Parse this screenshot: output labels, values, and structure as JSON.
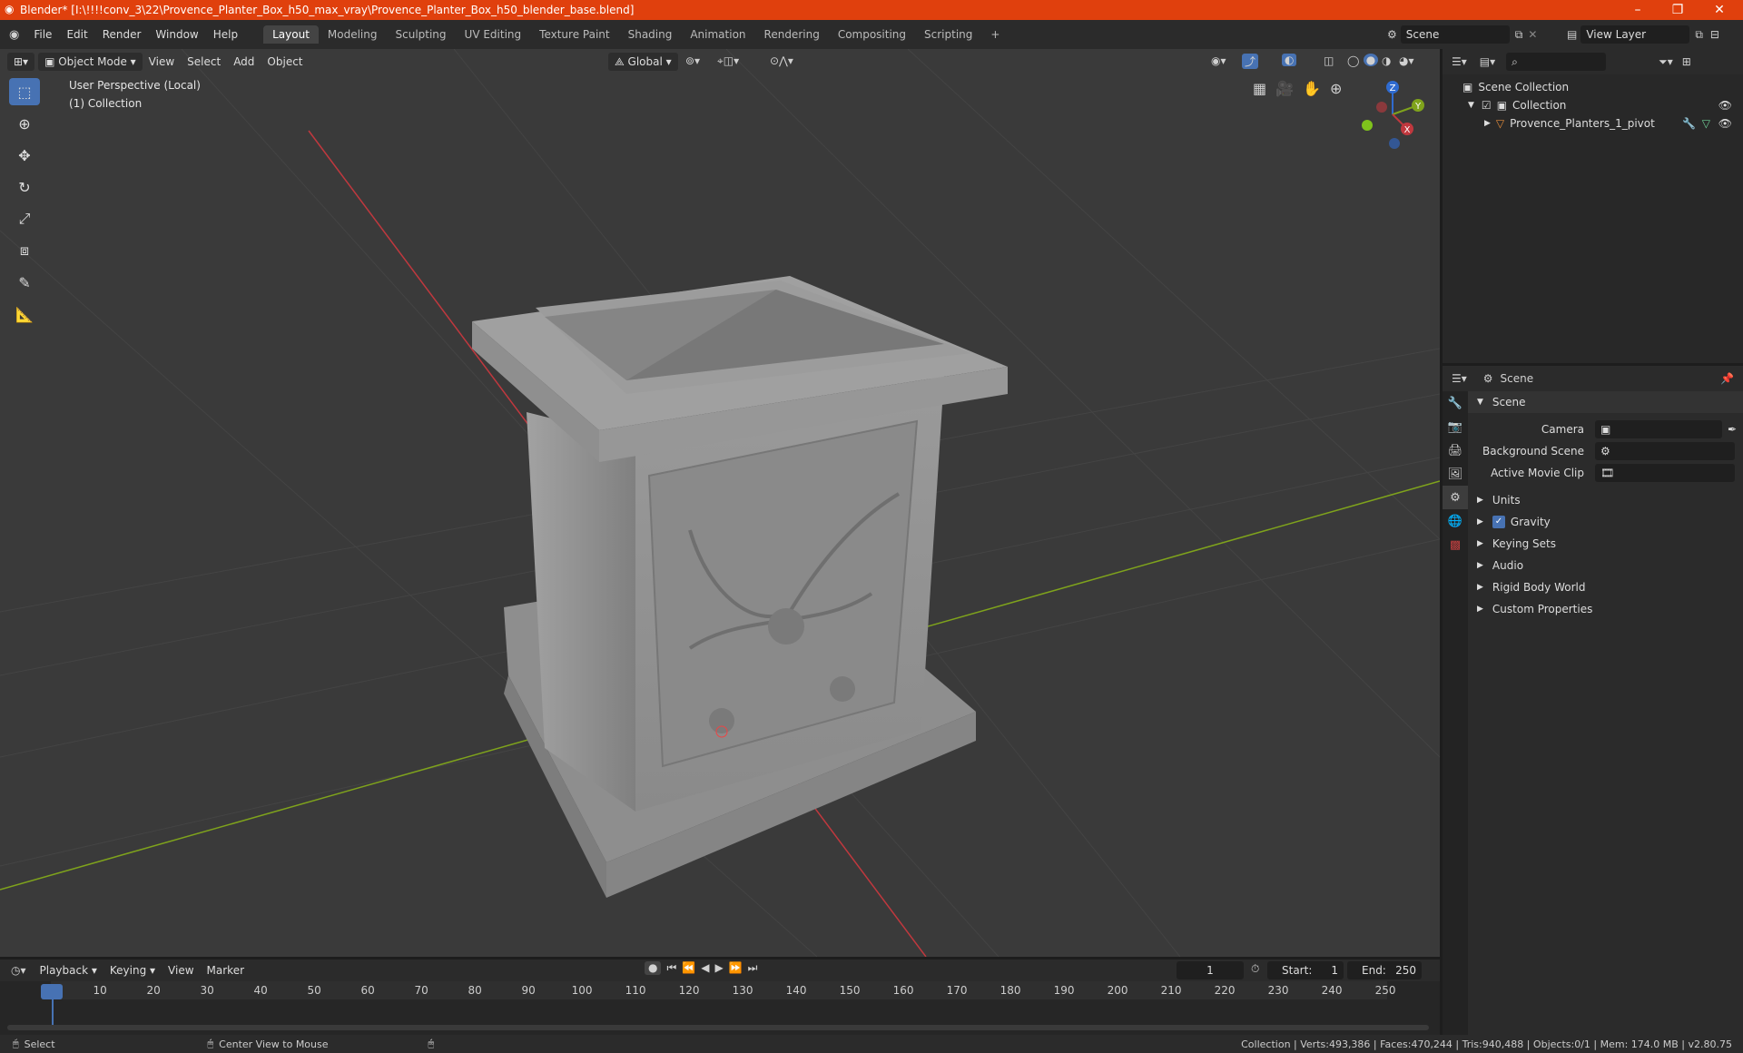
{
  "window": {
    "title": "Blender* [I:\\!!!!conv_3\\22\\Provence_Planter_Box_h50_max_vray\\Provence_Planter_Box_h50_blender_base.blend]",
    "minimize": "–",
    "maximize": "❐",
    "close": "✕"
  },
  "menu": [
    "File",
    "Edit",
    "Render",
    "Window",
    "Help"
  ],
  "workspaces": [
    "Layout",
    "Modeling",
    "Sculpting",
    "UV Editing",
    "Texture Paint",
    "Shading",
    "Animation",
    "Rendering",
    "Compositing",
    "Scripting"
  ],
  "active_workspace": "Layout",
  "add_workspace": "+",
  "scene_field": "Scene",
  "view_layer_field": "View Layer",
  "viewport": {
    "mode": "Object Mode",
    "menus": [
      "View",
      "Select",
      "Add",
      "Object"
    ],
    "transform_orientation": "Global",
    "overlay_line1": "User Perspective (Local)",
    "overlay_line2": "(1) Collection",
    "gizmo": {
      "z": "Z",
      "y": "Y",
      "x": "X"
    }
  },
  "outliner": {
    "root": "Scene Collection",
    "collection": "Collection",
    "object": "Provence_Planters_1_pivot"
  },
  "properties": {
    "header": "Scene",
    "panel": "Scene",
    "camera_label": "Camera",
    "background_scene_label": "Background Scene",
    "active_movie_clip_label": "Active Movie Clip",
    "subpanels": [
      "Units",
      "Gravity",
      "Keying Sets",
      "Audio",
      "Rigid Body World",
      "Custom Properties"
    ],
    "gravity_checked": true
  },
  "timeline": {
    "menus": [
      "Playback",
      "Keying",
      "View",
      "Marker"
    ],
    "current_frame": "1",
    "start_label": "Start:",
    "start_value": "1",
    "end_label": "End:",
    "end_value": "250",
    "ticks": [
      "1",
      "10",
      "20",
      "30",
      "40",
      "50",
      "60",
      "70",
      "80",
      "90",
      "100",
      "110",
      "120",
      "130",
      "140",
      "150",
      "160",
      "170",
      "180",
      "190",
      "200",
      "210",
      "220",
      "230",
      "240",
      "250"
    ]
  },
  "status": {
    "select": "Select",
    "center_view": "Center View to Mouse",
    "stats": "Collection | Verts:493,386 | Faces:470,244 | Tris:940,488 | Objects:0/1 | Mem: 174.0 MB | v2.80.75"
  },
  "colors": {
    "title_bar": "#e0400d",
    "accent": "#4772b3",
    "axis_x": "#c0383e",
    "axis_y": "#7fa31c"
  }
}
